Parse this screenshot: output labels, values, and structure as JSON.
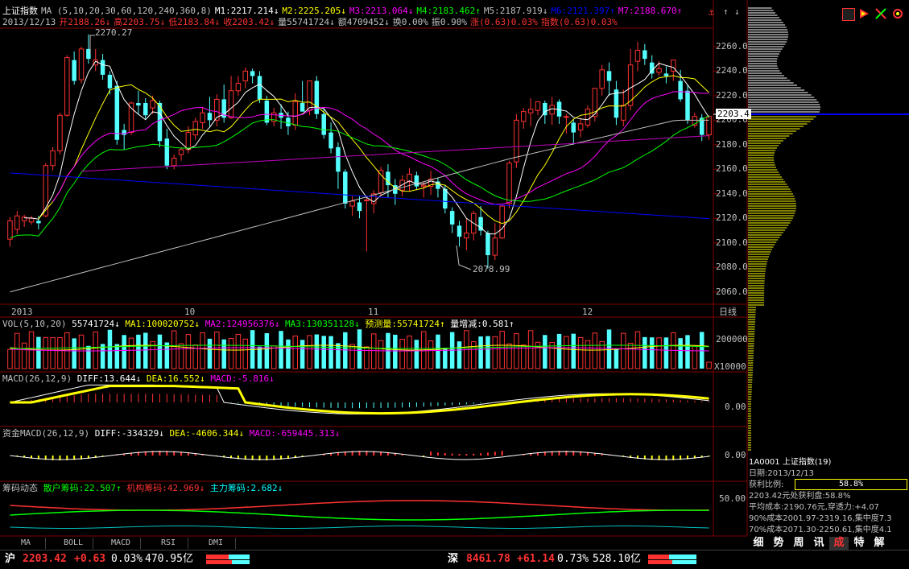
{
  "header": {
    "line1": {
      "index_name": "上证指数",
      "ma_params": "MA (5,10,20,30,60,120,240,360,8)",
      "m1": "M1:2217.214↓",
      "m2": "M2:2225.205↓",
      "m3": "M3:2213.064↓",
      "m4": "M4:2183.462↑",
      "m5": "M5:2187.919↓",
      "m6": "M6:2121.397↑",
      "m7": "M7:2188.670↑"
    },
    "line2": {
      "date": "2013/12/13",
      "open": "开2188.26↓",
      "high": "高2203.75↓",
      "low": "低2183.84↓",
      "close": "收2203.42↓",
      "volume": "量55741724↓",
      "amount": "额4709452↓",
      "turnover": "换0.00%",
      "amplitude": "振0.90%",
      "change": "涨(0.63)0.03%",
      "index_change": "指数(0.63)0.03%"
    }
  },
  "colors": {
    "up": "#ff3232",
    "down": "#54ffff",
    "ma5": "#ffffff",
    "ma10": "#ffff00",
    "ma20": "#ff00ff",
    "ma30": "#00ff00",
    "ma60": "#c0c0c0",
    "ma120": "#0000ff",
    "ma240": "#ff00ff",
    "grid": "#800000"
  },
  "price_axis": {
    "ticks": [
      "2260.0",
      "2240.0",
      "2220.0",
      "2200.0",
      "2180.0",
      "2160.0",
      "2140.0",
      "2120.0",
      "2100.0",
      "2080.0",
      "2060.0"
    ],
    "current": "2203.4"
  },
  "annotations": {
    "high_mark": "2270.27",
    "low_mark": "2078.99"
  },
  "date_axis": {
    "labels": [
      "2013",
      "10",
      "11",
      "12"
    ],
    "period": "日线"
  },
  "vol_panel": {
    "label": "VOL(5,10,20)",
    "value": "55741724↓",
    "ma1": "MA1:100020752↓",
    "ma2": "MA2:124956376↓",
    "ma3": "MA3:130351128↓",
    "forecast": "预测量:55741724↑",
    "ratio": "量增减:0.581↑",
    "tick_top": "200000",
    "tick_unit": "X10000"
  },
  "macd_panel": {
    "label": "MACD(26,12,9)",
    "diff": "DIFF:13.644↓",
    "dea": "DEA:16.552↓",
    "macd": "MACD:-5.816↓",
    "tick": "0.00"
  },
  "fund_macd_panel": {
    "label": "资金MACD(26,12,9)",
    "diff": "DIFF:-334329↓",
    "dea": "DEA:-4606.344↓",
    "macd": "MACD:-659445.313↓",
    "tick": "0.00"
  },
  "chip_panel": {
    "label": "筹码动态",
    "retail": "散户筹码:22.507↑",
    "inst": "机构筹码:42.969↓",
    "main": "主力筹码:2.682↓",
    "tick": "50.00"
  },
  "bottom_tabs": [
    "MA",
    "BOLL",
    "MACD",
    "RSI",
    "DMI"
  ],
  "chip_info": {
    "code": "1A0001 上证指数(19)",
    "date": "日期:2013/12/13",
    "profit_label": "获利比例:",
    "profit_value": "58.8%",
    "line1": "2203.42元处获利盘:58.8%",
    "line2": "平均成本:2190.76元,穿透力:+4.07",
    "line3": "90%成本2001.97-2319.16,集中度7.3",
    "line4": "70%成本2071.30-2250.61,集中度4.1"
  },
  "side_tabs": [
    "细",
    "势",
    "周",
    "讯",
    "成",
    "特",
    "解"
  ],
  "status_bar": {
    "sh_label": "沪",
    "sh_price": "2203.42",
    "sh_change": "+0.63",
    "sh_pct": "0.03%",
    "sh_amount": "470.95亿",
    "sz_label": "深",
    "sz_price": "8461.78",
    "sz_change": "+61.14",
    "sz_pct": "0.73%",
    "sz_amount": "528.10亿"
  },
  "chart_data": {
    "type": "candlestick",
    "ylim": [
      2050,
      2275
    ],
    "candles": [
      [
        2103,
        2118,
        2097,
        2121
      ],
      [
        2111,
        2122,
        2107,
        2126
      ],
      [
        2118,
        2121,
        2113,
        2123
      ],
      [
        2117,
        2120,
        2115,
        2122
      ],
      [
        2118,
        2116,
        2111,
        2122
      ],
      [
        2122,
        2163,
        2121,
        2165
      ],
      [
        2163,
        2175,
        2159,
        2178
      ],
      [
        2175,
        2204,
        2172,
        2206
      ],
      [
        2204,
        2251,
        2203,
        2253
      ],
      [
        2249,
        2232,
        2229,
        2256
      ],
      [
        2233,
        2258,
        2230,
        2260
      ],
      [
        2258,
        2250,
        2246,
        2270
      ],
      [
        2245,
        2249,
        2240,
        2258
      ],
      [
        2249,
        2237,
        2233,
        2254
      ],
      [
        2237,
        2226,
        2221,
        2240
      ],
      [
        2228,
        2184,
        2180,
        2232
      ],
      [
        2192,
        2188,
        2176,
        2197
      ],
      [
        2190,
        2214,
        2188,
        2215
      ],
      [
        2214,
        2212,
        2205,
        2224
      ],
      [
        2214,
        2204,
        2201,
        2218
      ],
      [
        2210,
        2216,
        2205,
        2220
      ],
      [
        2214,
        2183,
        2178,
        2216
      ],
      [
        2185,
        2163,
        2160,
        2193
      ],
      [
        2163,
        2169,
        2160,
        2172
      ],
      [
        2172,
        2176,
        2167,
        2178
      ],
      [
        2176,
        2190,
        2173,
        2195
      ],
      [
        2188,
        2199,
        2184,
        2202
      ],
      [
        2198,
        2206,
        2193,
        2210
      ],
      [
        2206,
        2200,
        2194,
        2219
      ],
      [
        2200,
        2217,
        2195,
        2221
      ],
      [
        2217,
        2202,
        2198,
        2229
      ],
      [
        2202,
        2224,
        2201,
        2236
      ],
      [
        2224,
        2230,
        2220,
        2236
      ],
      [
        2232,
        2240,
        2226,
        2243
      ],
      [
        2240,
        2236,
        2230,
        2242
      ],
      [
        2236,
        2217,
        2214,
        2240
      ],
      [
        2216,
        2198,
        2196,
        2220
      ],
      [
        2199,
        2206,
        2195,
        2210
      ],
      [
        2206,
        2202,
        2193,
        2213
      ],
      [
        2202,
        2195,
        2188,
        2207
      ],
      [
        2196,
        2215,
        2192,
        2222
      ],
      [
        2214,
        2207,
        2207,
        2232
      ],
      [
        2208,
        2232,
        2204,
        2232
      ],
      [
        2232,
        2205,
        2201,
        2236
      ],
      [
        2205,
        2188,
        2185,
        2210
      ],
      [
        2190,
        2177,
        2173,
        2198
      ],
      [
        2178,
        2158,
        2144,
        2182
      ],
      [
        2158,
        2132,
        2128,
        2160
      ],
      [
        2130,
        2134,
        2122,
        2138
      ],
      [
        2133,
        2126,
        2120,
        2138
      ],
      [
        2135,
        2135,
        2093,
        2137
      ],
      [
        2132,
        2140,
        2124,
        2143
      ],
      [
        2141,
        2159,
        2138,
        2162
      ],
      [
        2158,
        2147,
        2137,
        2164
      ],
      [
        2147,
        2140,
        2131,
        2152
      ],
      [
        2143,
        2151,
        2138,
        2155
      ],
      [
        2150,
        2156,
        2142,
        2161
      ],
      [
        2155,
        2146,
        2143,
        2158
      ],
      [
        2146,
        2147,
        2137,
        2150
      ],
      [
        2146,
        2152,
        2139,
        2159
      ],
      [
        2150,
        2144,
        2137,
        2153
      ],
      [
        2144,
        2128,
        2124,
        2147
      ],
      [
        2126,
        2115,
        2108,
        2129
      ],
      [
        2114,
        2105,
        2097,
        2118
      ],
      [
        2104,
        2108,
        2094,
        2120
      ],
      [
        2108,
        2124,
        2102,
        2126
      ],
      [
        2121,
        2110,
        2106,
        2130
      ],
      [
        2108,
        2090,
        2079,
        2110
      ],
      [
        2090,
        2104,
        2086,
        2116
      ],
      [
        2104,
        2130,
        2103,
        2131
      ],
      [
        2132,
        2165,
        2128,
        2167
      ],
      [
        2166,
        2200,
        2161,
        2205
      ],
      [
        2199,
        2207,
        2193,
        2210
      ],
      [
        2206,
        2209,
        2195,
        2218
      ],
      [
        2208,
        2215,
        2204,
        2215
      ],
      [
        2214,
        2204,
        2197,
        2216
      ],
      [
        2205,
        2212,
        2196,
        2219
      ],
      [
        2215,
        2203,
        2197,
        2217
      ],
      [
        2203,
        2203,
        2189,
        2205
      ],
      [
        2198,
        2190,
        2180,
        2201
      ],
      [
        2192,
        2197,
        2186,
        2202
      ],
      [
        2196,
        2209,
        2194,
        2212
      ],
      [
        2203,
        2226,
        2199,
        2226
      ],
      [
        2226,
        2241,
        2220,
        2245
      ],
      [
        2240,
        2232,
        2220,
        2247
      ],
      [
        2225,
        2202,
        2196,
        2232
      ],
      [
        2200,
        2212,
        2195,
        2225
      ],
      [
        2212,
        2245,
        2208,
        2258
      ],
      [
        2248,
        2257,
        2240,
        2264
      ],
      [
        2257,
        2250,
        2245,
        2262
      ],
      [
        2247,
        2238,
        2234,
        2253
      ],
      [
        2239,
        2242,
        2236,
        2248
      ],
      [
        2238,
        2236,
        2230,
        2244
      ],
      [
        2240,
        2249,
        2232,
        2249
      ],
      [
        2232,
        2217,
        2215,
        2241
      ],
      [
        2224,
        2200,
        2197,
        2229
      ],
      [
        2196,
        2203,
        2194,
        2206
      ],
      [
        2202,
        2188,
        2183,
        2205
      ],
      [
        2188,
        2203,
        2184,
        2204
      ]
    ]
  }
}
